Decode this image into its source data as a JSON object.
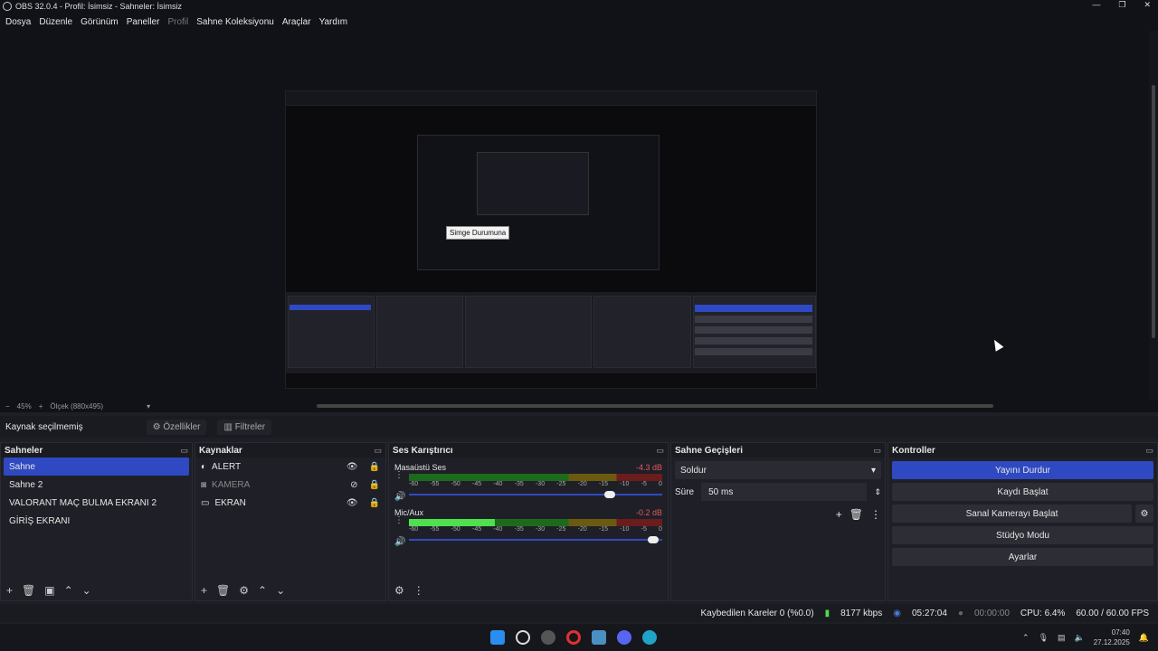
{
  "window": {
    "title": "OBS 32.0.4 - Profil: İsimsiz - Sahneler: İsimsiz",
    "controls": [
      "—",
      "❐",
      "✕"
    ]
  },
  "menu": [
    "Dosya",
    "Düzenle",
    "Görünüm",
    "Paneller",
    "Profil",
    "Sahne Koleksiyonu",
    "Araçlar",
    "Yardım"
  ],
  "preview": {
    "tooltip": "Simge Durumuna",
    "zoom": "45%",
    "scale_label": "Ölçek (880x495)"
  },
  "source_bar": {
    "none_selected": "Kaynak seçilmemiş",
    "properties": "Özellikler",
    "filters": "Filtreler"
  },
  "scenes": {
    "title": "Sahneler",
    "items": [
      "Sahne",
      "Sahne 2",
      "VALORANT MAÇ BULMA EKRANI 2",
      "GİRİŞ EKRANI"
    ]
  },
  "sources": {
    "title": "Kaynaklar",
    "items": [
      "ALERT",
      "KAMERA",
      "EKRAN"
    ]
  },
  "mixer": {
    "title": "Ses Karıştırıcı",
    "channels": [
      {
        "name": "Masaüstü Ses",
        "db": "-4.3 dB",
        "level": 0.0
      },
      {
        "name": "Mic/Aux",
        "db": "-0.2 dB",
        "level": 0.34
      }
    ],
    "ticks": [
      "-60",
      "-55",
      "-50",
      "-45",
      "-40",
      "-35",
      "-30",
      "-25",
      "-20",
      "-15",
      "-10",
      "-5",
      "0"
    ]
  },
  "transitions": {
    "title": "Sahne Geçişleri",
    "selected": "Soldur",
    "duration_label": "Süre",
    "duration": "50 ms"
  },
  "controls": {
    "title": "Kontroller",
    "stop_stream": "Yayını Durdur",
    "start_record": "Kaydı Başlat",
    "virtual_cam": "Sanal Kamerayı Başlat",
    "studio": "Stüdyo Modu",
    "settings": "Ayarlar"
  },
  "status": {
    "dropped": "Kaybedilen Kareler 0 (%0.0)",
    "bitrate": "8177 kbps",
    "stream_time": "05:27:04",
    "record_time": "00:00:00",
    "cpu": "CPU: 6.4%",
    "fps": "60.00 / 60.00 FPS"
  },
  "clock": {
    "time": "07:40",
    "date": "27.12.2025"
  },
  "colors": {
    "accent": "#2f49c2",
    "green": "#4ee04e",
    "bg": "#1d1f26"
  }
}
